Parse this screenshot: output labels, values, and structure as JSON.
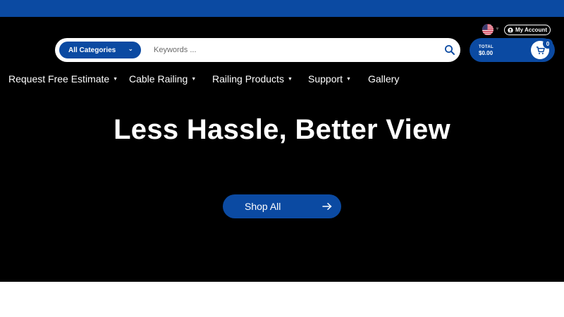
{
  "colors": {
    "brand_blue": "#0b4aa2",
    "hero_background": "#000000",
    "text_white": "#ffffff"
  },
  "header": {
    "flag_icon": "us-flag-icon",
    "account_icon": "user-icon",
    "account_label": "My Account"
  },
  "search": {
    "category_selected": "All Categories",
    "category_icon": "chevron-down-icon",
    "placeholder": "Keywords ...",
    "value": "",
    "search_icon": "search-icon"
  },
  "cart": {
    "total_label": "TOTAL",
    "total_value": "$0.00",
    "count": "0",
    "icon": "cart-icon"
  },
  "nav": {
    "items": [
      {
        "label": "Request Free Estimate",
        "has_dropdown": true
      },
      {
        "label": "Cable Railing",
        "has_dropdown": true
      },
      {
        "label": "Railing Products",
        "has_dropdown": true
      },
      {
        "label": "Support",
        "has_dropdown": true
      },
      {
        "label": "Gallery",
        "has_dropdown": false
      }
    ]
  },
  "hero": {
    "title": "Less Hassle, Better View",
    "cta_label": "Shop All",
    "cta_icon": "arrow-right-icon"
  }
}
